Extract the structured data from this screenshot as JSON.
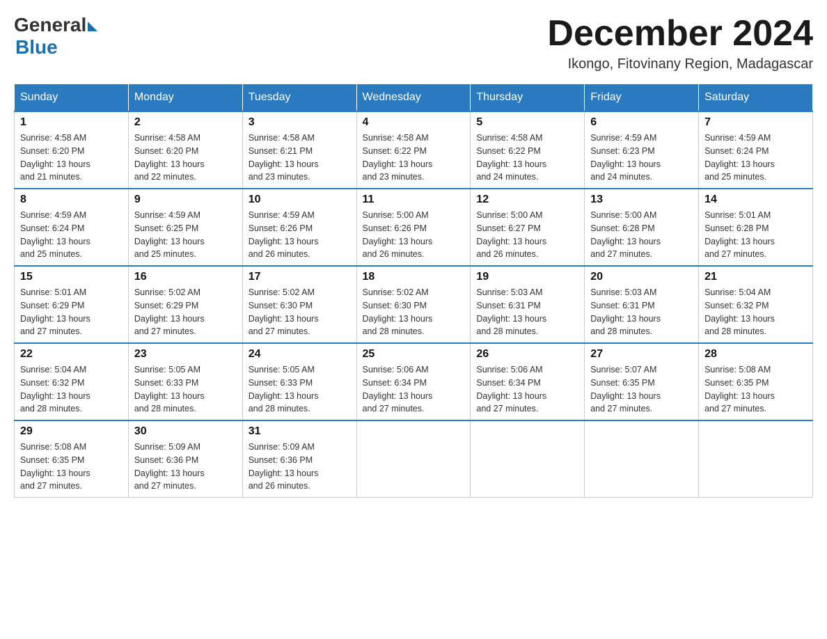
{
  "header": {
    "logo_general": "General",
    "logo_blue": "Blue",
    "title": "December 2024",
    "subtitle": "Ikongo, Fitovinany Region, Madagascar"
  },
  "weekdays": [
    "Sunday",
    "Monday",
    "Tuesday",
    "Wednesday",
    "Thursday",
    "Friday",
    "Saturday"
  ],
  "weeks": [
    [
      {
        "day": "1",
        "sunrise": "4:58 AM",
        "sunset": "6:20 PM",
        "daylight": "13 hours and 21 minutes."
      },
      {
        "day": "2",
        "sunrise": "4:58 AM",
        "sunset": "6:20 PM",
        "daylight": "13 hours and 22 minutes."
      },
      {
        "day": "3",
        "sunrise": "4:58 AM",
        "sunset": "6:21 PM",
        "daylight": "13 hours and 23 minutes."
      },
      {
        "day": "4",
        "sunrise": "4:58 AM",
        "sunset": "6:22 PM",
        "daylight": "13 hours and 23 minutes."
      },
      {
        "day": "5",
        "sunrise": "4:58 AM",
        "sunset": "6:22 PM",
        "daylight": "13 hours and 24 minutes."
      },
      {
        "day": "6",
        "sunrise": "4:59 AM",
        "sunset": "6:23 PM",
        "daylight": "13 hours and 24 minutes."
      },
      {
        "day": "7",
        "sunrise": "4:59 AM",
        "sunset": "6:24 PM",
        "daylight": "13 hours and 25 minutes."
      }
    ],
    [
      {
        "day": "8",
        "sunrise": "4:59 AM",
        "sunset": "6:24 PM",
        "daylight": "13 hours and 25 minutes."
      },
      {
        "day": "9",
        "sunrise": "4:59 AM",
        "sunset": "6:25 PM",
        "daylight": "13 hours and 25 minutes."
      },
      {
        "day": "10",
        "sunrise": "4:59 AM",
        "sunset": "6:26 PM",
        "daylight": "13 hours and 26 minutes."
      },
      {
        "day": "11",
        "sunrise": "5:00 AM",
        "sunset": "6:26 PM",
        "daylight": "13 hours and 26 minutes."
      },
      {
        "day": "12",
        "sunrise": "5:00 AM",
        "sunset": "6:27 PM",
        "daylight": "13 hours and 26 minutes."
      },
      {
        "day": "13",
        "sunrise": "5:00 AM",
        "sunset": "6:28 PM",
        "daylight": "13 hours and 27 minutes."
      },
      {
        "day": "14",
        "sunrise": "5:01 AM",
        "sunset": "6:28 PM",
        "daylight": "13 hours and 27 minutes."
      }
    ],
    [
      {
        "day": "15",
        "sunrise": "5:01 AM",
        "sunset": "6:29 PM",
        "daylight": "13 hours and 27 minutes."
      },
      {
        "day": "16",
        "sunrise": "5:02 AM",
        "sunset": "6:29 PM",
        "daylight": "13 hours and 27 minutes."
      },
      {
        "day": "17",
        "sunrise": "5:02 AM",
        "sunset": "6:30 PM",
        "daylight": "13 hours and 27 minutes."
      },
      {
        "day": "18",
        "sunrise": "5:02 AM",
        "sunset": "6:30 PM",
        "daylight": "13 hours and 28 minutes."
      },
      {
        "day": "19",
        "sunrise": "5:03 AM",
        "sunset": "6:31 PM",
        "daylight": "13 hours and 28 minutes."
      },
      {
        "day": "20",
        "sunrise": "5:03 AM",
        "sunset": "6:31 PM",
        "daylight": "13 hours and 28 minutes."
      },
      {
        "day": "21",
        "sunrise": "5:04 AM",
        "sunset": "6:32 PM",
        "daylight": "13 hours and 28 minutes."
      }
    ],
    [
      {
        "day": "22",
        "sunrise": "5:04 AM",
        "sunset": "6:32 PM",
        "daylight": "13 hours and 28 minutes."
      },
      {
        "day": "23",
        "sunrise": "5:05 AM",
        "sunset": "6:33 PM",
        "daylight": "13 hours and 28 minutes."
      },
      {
        "day": "24",
        "sunrise": "5:05 AM",
        "sunset": "6:33 PM",
        "daylight": "13 hours and 28 minutes."
      },
      {
        "day": "25",
        "sunrise": "5:06 AM",
        "sunset": "6:34 PM",
        "daylight": "13 hours and 27 minutes."
      },
      {
        "day": "26",
        "sunrise": "5:06 AM",
        "sunset": "6:34 PM",
        "daylight": "13 hours and 27 minutes."
      },
      {
        "day": "27",
        "sunrise": "5:07 AM",
        "sunset": "6:35 PM",
        "daylight": "13 hours and 27 minutes."
      },
      {
        "day": "28",
        "sunrise": "5:08 AM",
        "sunset": "6:35 PM",
        "daylight": "13 hours and 27 minutes."
      }
    ],
    [
      {
        "day": "29",
        "sunrise": "5:08 AM",
        "sunset": "6:35 PM",
        "daylight": "13 hours and 27 minutes."
      },
      {
        "day": "30",
        "sunrise": "5:09 AM",
        "sunset": "6:36 PM",
        "daylight": "13 hours and 27 minutes."
      },
      {
        "day": "31",
        "sunrise": "5:09 AM",
        "sunset": "6:36 PM",
        "daylight": "13 hours and 26 minutes."
      },
      null,
      null,
      null,
      null
    ]
  ]
}
